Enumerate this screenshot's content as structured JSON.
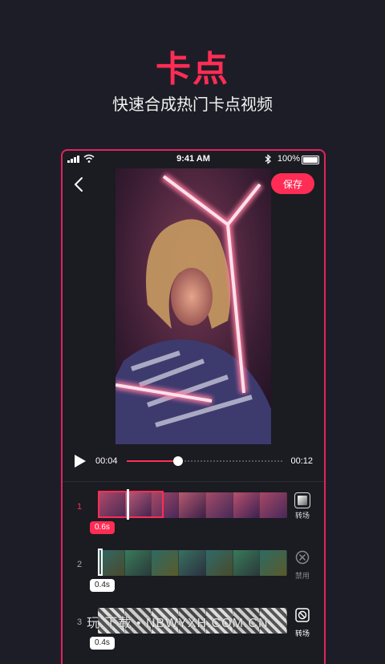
{
  "hero": {
    "title": "卡点",
    "subtitle": "快速合成热门卡点视频"
  },
  "status_bar": {
    "time": "9:41 AM",
    "battery": "100%"
  },
  "header": {
    "save_label": "保存"
  },
  "player": {
    "current_time": "00:04",
    "duration": "00:12",
    "progress": 0.33
  },
  "clips": [
    {
      "index": "1",
      "duration": "0.6s",
      "action": "转场",
      "selected": true
    },
    {
      "index": "2",
      "duration": "0.4s",
      "action": "禁用",
      "selected": false
    },
    {
      "index": "3",
      "duration": "0.4s",
      "action": "转场",
      "selected": false
    }
  ],
  "watermark": "玩.下载 • NBWYXH.COM.CN",
  "colors": {
    "accent": "#ff2d55",
    "background": "#1d1d27"
  }
}
